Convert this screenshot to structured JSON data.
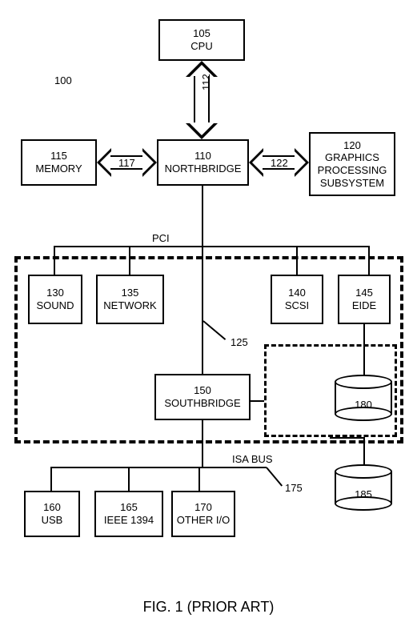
{
  "diagram_ref": "100",
  "caption": "FIG. 1 (PRIOR ART)",
  "buses": {
    "pci": "PCI",
    "isa": "ISA BUS"
  },
  "pci_ref": "125",
  "isa_ref": "175",
  "arrows": {
    "a112": "112",
    "a117": "117",
    "a122": "122"
  },
  "blocks": {
    "cpu": {
      "ref": "105",
      "label": "CPU"
    },
    "memory": {
      "ref": "115",
      "label": "MEMORY"
    },
    "northbridge": {
      "ref": "110",
      "label": "NORTHBRIDGE"
    },
    "graphics": {
      "ref": "120",
      "label": "GRAPHICS PROCESSING SUBSYSTEM"
    },
    "sound": {
      "ref": "130",
      "label": "SOUND"
    },
    "network": {
      "ref": "135",
      "label": "NETWORK"
    },
    "scsi": {
      "ref": "140",
      "label": "SCSI"
    },
    "eide": {
      "ref": "145",
      "label": "EIDE"
    },
    "southbridge": {
      "ref": "150",
      "label": "SOUTHBRIDGE"
    },
    "usb": {
      "ref": "160",
      "label": "USB"
    },
    "ieee1394": {
      "ref": "165",
      "label": "IEEE 1394"
    },
    "otherio": {
      "ref": "170",
      "label": "OTHER I/O"
    }
  },
  "disks": {
    "d180": "180",
    "d185": "185"
  }
}
